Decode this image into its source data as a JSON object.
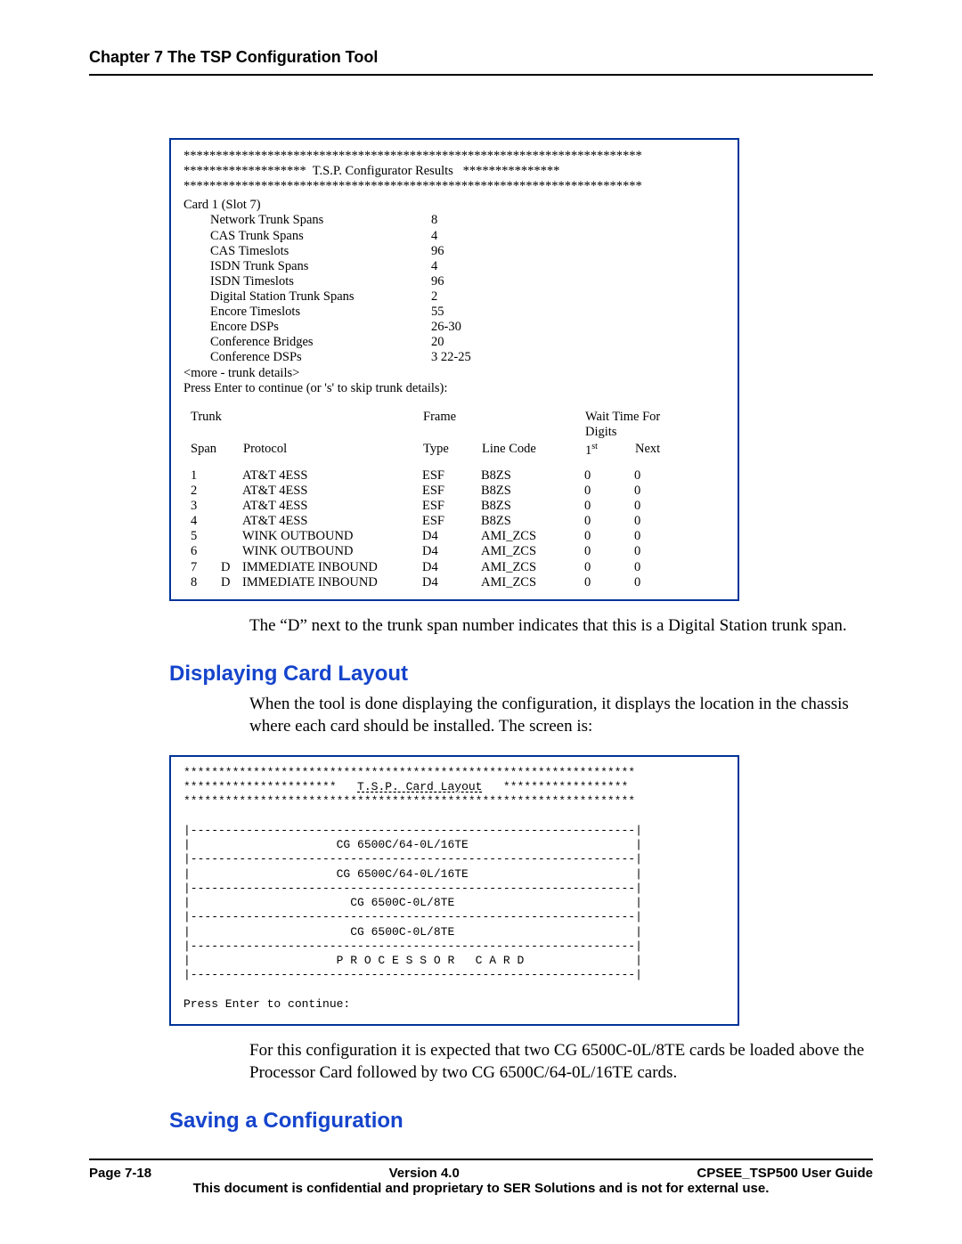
{
  "header": {
    "chapter": "Chapter 7 The TSP Configuration Tool"
  },
  "box1": {
    "star_line": "***********************************************************************",
    "title_line": "*******************  T.S.P. Configurator Results   ***************",
    "card_line": "Card  1 (Slot 7)",
    "specs": [
      {
        "label": "Network Trunk Spans",
        "value": "8"
      },
      {
        "label": "CAS Trunk Spans",
        "value": "4"
      },
      {
        "label": "CAS Timeslots",
        "value": "96"
      },
      {
        "label": "ISDN Trunk Spans",
        "value": "4"
      },
      {
        "label": "ISDN Timeslots",
        "value": "96"
      },
      {
        "label": "Digital Station Trunk Spans",
        "value": "2"
      },
      {
        "label": "Encore Timeslots",
        "value": "55"
      },
      {
        "label": "Encore DSPs",
        "value": "26-30"
      },
      {
        "label": "Conference Bridges",
        "value": "20"
      },
      {
        "label": "Conference DSPs",
        "value": "3 22-25"
      }
    ],
    "more_line": "<more - trunk details>",
    "press_line": "Press Enter to continue (or 's' to skip trunk details):",
    "trunk_hdr": {
      "trunk": "Trunk",
      "frame": "Frame",
      "wait": "Wait Time For Digits",
      "span": "Span",
      "proto": "Protocol",
      "type": "Type",
      "line": "Line Code",
      "first": "1",
      "ord": "st",
      "next": "Next"
    },
    "rows": [
      {
        "span": "1",
        "flag": "",
        "proto": "AT&T 4ESS",
        "ftype": "ESF",
        "lcode": "B8ZS",
        "w1": "0",
        "w2": "0"
      },
      {
        "span": "2",
        "flag": "",
        "proto": "AT&T 4ESS",
        "ftype": "ESF",
        "lcode": "B8ZS",
        "w1": "0",
        "w2": "0"
      },
      {
        "span": "3",
        "flag": "",
        "proto": "AT&T 4ESS",
        "ftype": "ESF",
        "lcode": "B8ZS",
        "w1": "0",
        "w2": "0"
      },
      {
        "span": "4",
        "flag": "",
        "proto": "AT&T 4ESS",
        "ftype": "ESF",
        "lcode": "B8ZS",
        "w1": "0",
        "w2": "0"
      },
      {
        "span": "5",
        "flag": "",
        "proto": "WINK OUTBOUND",
        "ftype": "D4",
        "lcode": "AMI_ZCS",
        "w1": "0",
        "w2": "0"
      },
      {
        "span": "6",
        "flag": "",
        "proto": "WINK OUTBOUND",
        "ftype": "D4",
        "lcode": "AMI_ZCS",
        "w1": "0",
        "w2": "0"
      },
      {
        "span": "7",
        "flag": "D",
        "proto": "IMMEDIATE INBOUND",
        "ftype": "D4",
        "lcode": "AMI_ZCS",
        "w1": "0",
        "w2": "0"
      },
      {
        "span": "8",
        "flag": "D",
        "proto": "IMMEDIATE INBOUND",
        "ftype": "D4",
        "lcode": "AMI_ZCS",
        "w1": "0",
        "w2": "0"
      }
    ]
  },
  "para1": "The “D” next to the trunk span number indicates that this is a Digital Station trunk span.",
  "heading1": "Displaying Card Layout",
  "para2": "When the tool is done displaying the configuration, it displays the location in the chassis where each card should be installed.  The screen is:",
  "box2": {
    "star_line": "*****************************************************************",
    "title_mid": "T.S.P. Card Layout",
    "title_line_left": "**********************   ",
    "title_line_right": "   ******************",
    "div": "|----------------------------------------------------------------|",
    "rows": [
      "|                     CG 6500C/64-0L/16TE                        |",
      "|                     CG 6500C/64-0L/16TE                        |",
      "|                       CG 6500C-0L/8TE                          |",
      "|                       CG 6500C-0L/8TE                          |",
      "|                     P R O C E S S O R   C A R D                |"
    ],
    "press": "Press Enter to continue:"
  },
  "para3": "For this configuration it is expected that two CG 6500C-0L/8TE cards be loaded above the Processor Card followed by two CG 6500C/64-0L/16TE cards.",
  "heading2": "Saving a Configuration",
  "footer": {
    "page": "Page 7-18",
    "version": "Version 4.0",
    "guide": "CPSEE_TSP500 User Guide",
    "conf": "This document is confidential and proprietary to SER Solutions and is not for external use."
  }
}
